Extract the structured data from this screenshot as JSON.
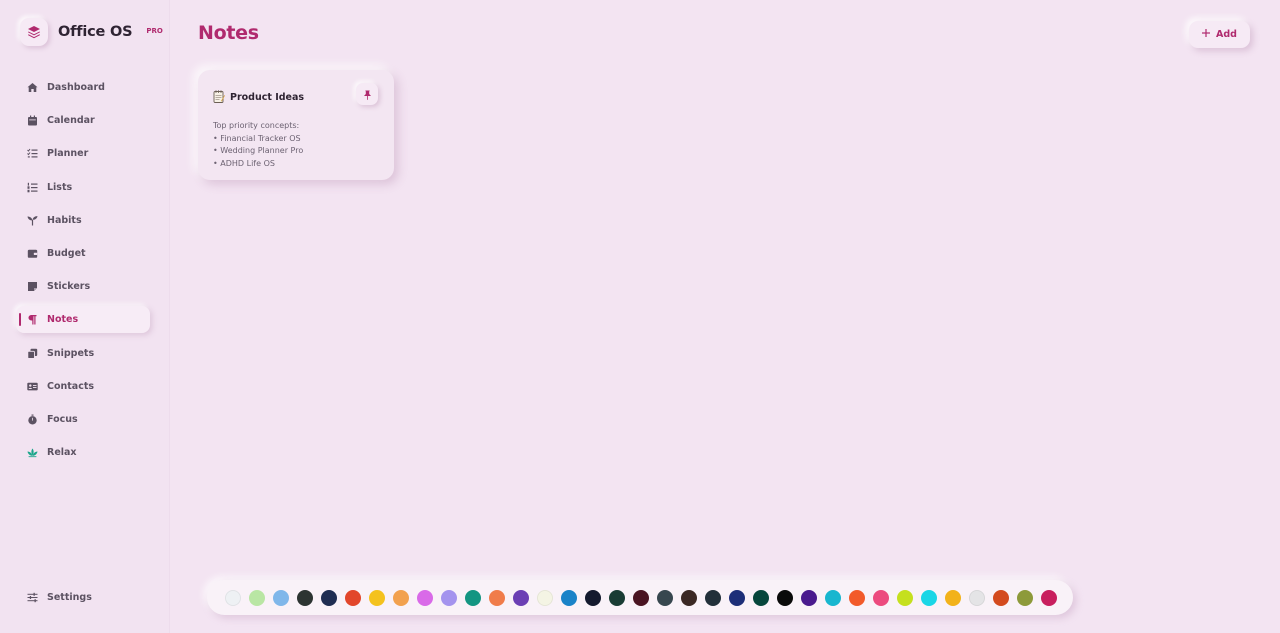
{
  "app": {
    "name": "Office OS",
    "tag": "PRO"
  },
  "sidebar": {
    "items": [
      {
        "label": "Dashboard",
        "icon": "home-icon"
      },
      {
        "label": "Calendar",
        "icon": "calendar-icon"
      },
      {
        "label": "Planner",
        "icon": "checklist-icon"
      },
      {
        "label": "Lists",
        "icon": "numbered-list-icon"
      },
      {
        "label": "Habits",
        "icon": "sprout-icon"
      },
      {
        "label": "Budget",
        "icon": "wallet-icon"
      },
      {
        "label": "Stickers",
        "icon": "sticky-note-icon"
      },
      {
        "label": "Notes",
        "icon": "paragraph-icon",
        "active": true
      },
      {
        "label": "Snippets",
        "icon": "copy-icon"
      },
      {
        "label": "Contacts",
        "icon": "address-card-icon"
      },
      {
        "label": "Focus",
        "icon": "stopwatch-icon"
      },
      {
        "label": "Relax",
        "icon": "lotus-icon"
      }
    ],
    "settings": {
      "label": "Settings",
      "icon": "sliders-icon"
    }
  },
  "main": {
    "title": "Notes",
    "add_button": "Add",
    "notes": [
      {
        "title": "Product Ideas",
        "icon": "notepad-icon",
        "lines": [
          "Top priority concepts:",
          "• Financial Tracker OS",
          "• Wedding Planner Pro",
          "• ADHD Life OS"
        ]
      }
    ]
  },
  "palette": {
    "colors": [
      "#eef1f4",
      "#b9e6a4",
      "#7fb7ea",
      "#2c3432",
      "#1f2d52",
      "#e2462b",
      "#f4c21e",
      "#f2a14e",
      "#d96ae8",
      "#a493ee",
      "#139582",
      "#f07c4a",
      "#6b3fb4",
      "#f4f4e4",
      "#1a83c8",
      "#141a2e",
      "#193c34",
      "#4a1422",
      "#37474f",
      "#3b2824",
      "#22303a",
      "#1d2e78",
      "#06463c",
      "#0a0a0a",
      "#4a1a8e",
      "#18b6cf",
      "#f25a2a",
      "#ec4a7e",
      "#c5e01e",
      "#1ad6e6",
      "#f2b21a",
      "#e4e4e6",
      "#d34a1e",
      "#8d9a3a",
      "#c81f5e"
    ]
  }
}
